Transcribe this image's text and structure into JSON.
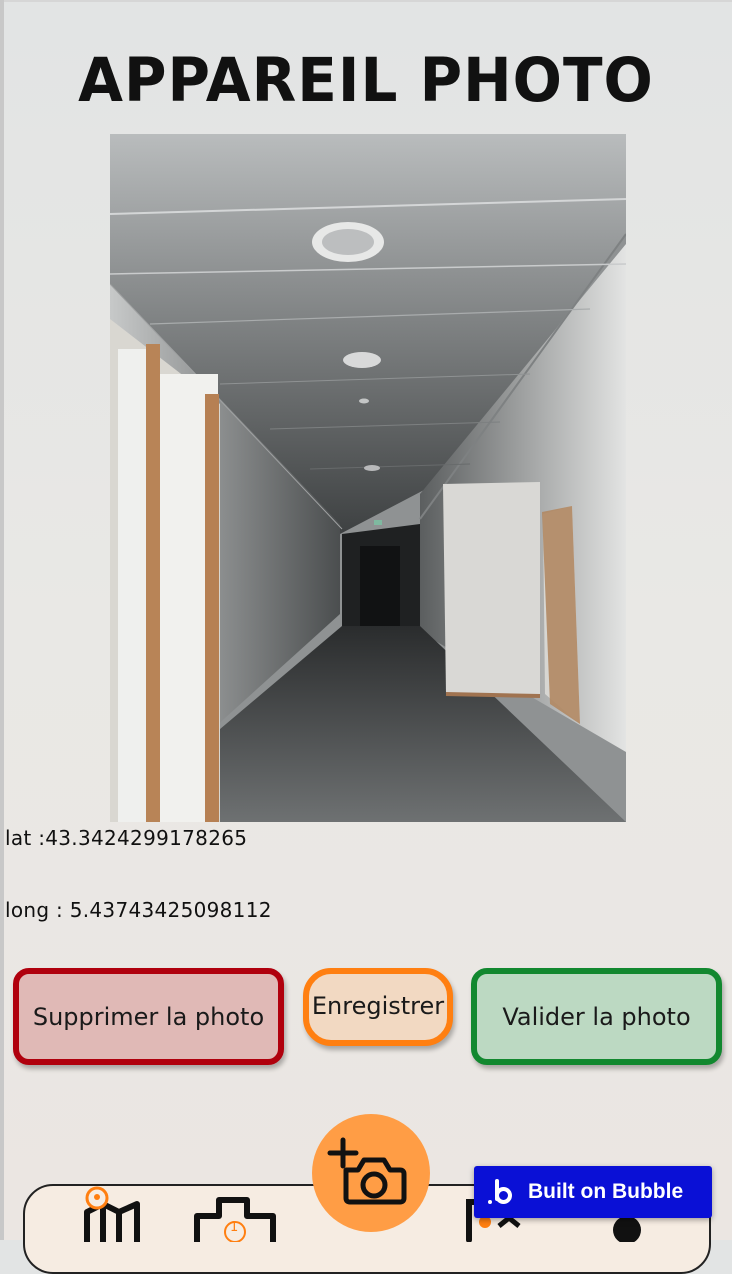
{
  "page": {
    "title": "APPAREIL PHOTO"
  },
  "photo": {
    "subject": "corridor-photo"
  },
  "coordinates": {
    "lat_text": "lat :43.3424299178265",
    "long_text": "long : 5.43743425098112"
  },
  "actions": {
    "delete_label": "Supprimer la photo",
    "save_label": "Enregistrer",
    "validate_label": "Valider la photo"
  },
  "colors": {
    "delete_border": "#b0000d",
    "delete_fill": "#e0b9b6",
    "save_border": "#ff7f11",
    "save_fill": "#f2d9c2",
    "validate_border": "#12882f",
    "validate_fill": "#bcd9c2",
    "fab": "#ff9d45",
    "bubble_badge": "#0a10d6"
  },
  "bottom_nav": {
    "items": [
      {
        "icon": "map-pin-icon"
      },
      {
        "icon": "building-count-icon",
        "badge": "1"
      },
      {
        "icon": "camera-add-icon"
      },
      {
        "icon": "photo-notification-icon"
      },
      {
        "icon": "profile-icon"
      }
    ]
  },
  "badge": {
    "label": "Built on Bubble"
  }
}
